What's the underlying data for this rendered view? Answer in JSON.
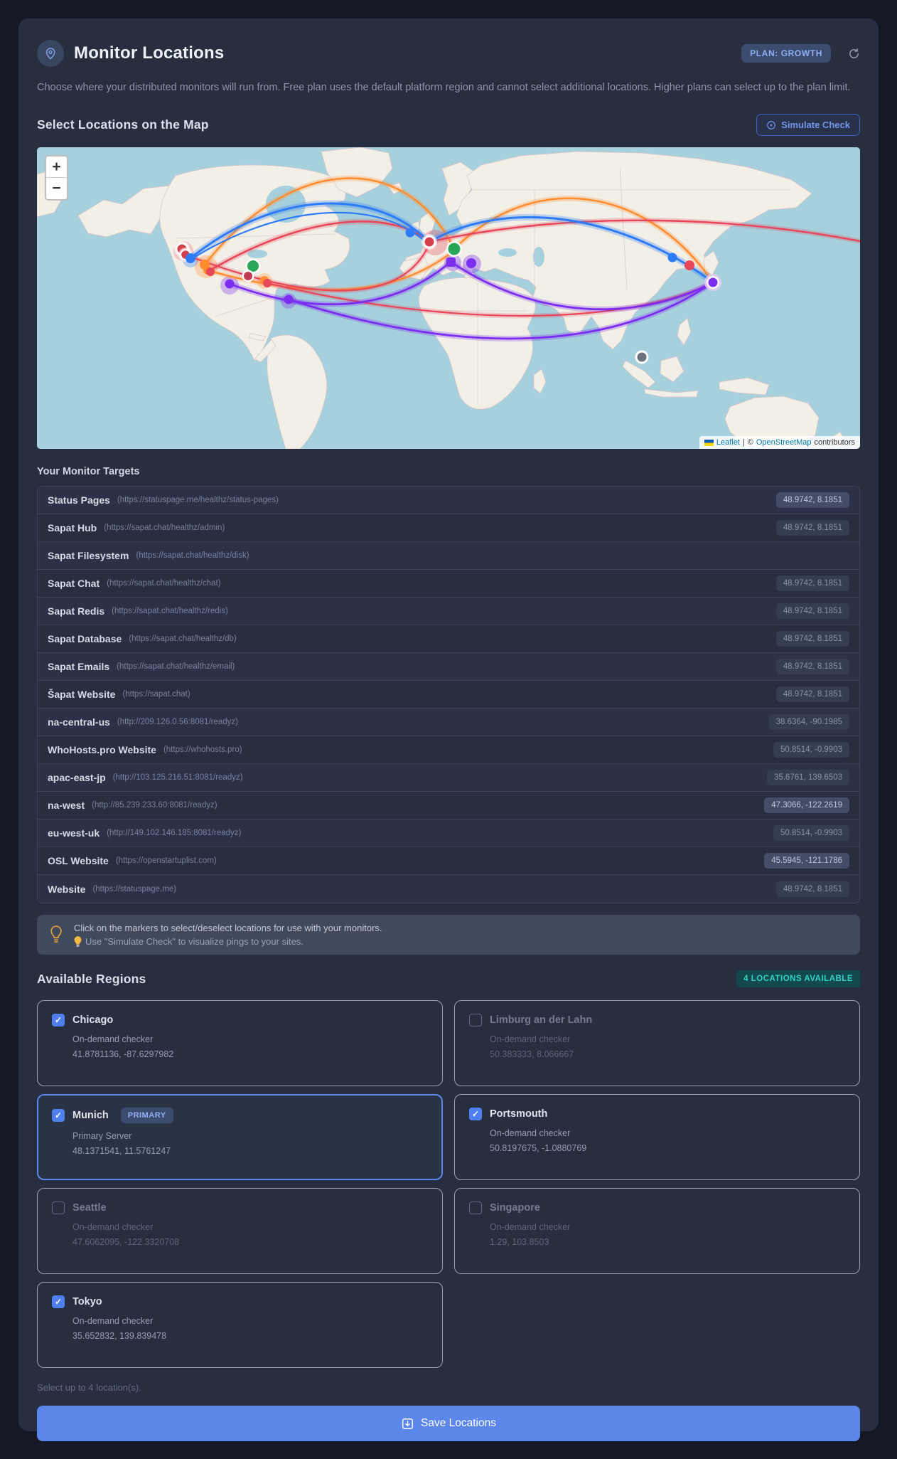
{
  "header": {
    "title": "Monitor Locations",
    "plan_badge": "PLAN: GROWTH",
    "description": "Choose where your distributed monitors will run from. Free plan uses the default platform region and cannot select additional locations. Higher plans can select up to the plan limit."
  },
  "map_section": {
    "heading": "Select Locations on the Map",
    "simulate_button": "Simulate Check",
    "zoom_in": "+",
    "zoom_out": "−",
    "attribution": {
      "leaflet_link": "Leaflet",
      "separator": "|",
      "copyright": "©",
      "osm_link": "OpenStreetMap",
      "suffix": "contributors"
    }
  },
  "map_palette": {
    "blue": "#2e7bf6",
    "orange": "#ff8c2e",
    "red": "#e8465a",
    "purple": "#7c2ef0",
    "green": "#27a658",
    "gray": "#6b7280",
    "water": "#a7d0dd",
    "land": "#f2efe6"
  },
  "targets": {
    "heading": "Your Monitor Targets",
    "items": [
      {
        "name": "Status Pages",
        "url": "(https://statuspage.me/healthz/status-pages)",
        "coords": "48.9742, 8.1851",
        "bright": true
      },
      {
        "name": "Sapat Hub",
        "url": "(https://sapat.chat/healthz/admin)",
        "coords": "48.9742, 8.1851",
        "bright": false
      },
      {
        "name": "Sapat Filesystem",
        "url": "(https://sapat.chat/healthz/disk)",
        "coords": "",
        "bright": false
      },
      {
        "name": "Sapat Chat",
        "url": "(https://sapat.chat/healthz/chat)",
        "coords": "48.9742, 8.1851",
        "bright": false
      },
      {
        "name": "Sapat Redis",
        "url": "(https://sapat.chat/healthz/redis)",
        "coords": "48.9742, 8.1851",
        "bright": false
      },
      {
        "name": "Sapat Database",
        "url": "(https://sapat.chat/healthz/db)",
        "coords": "48.9742, 8.1851",
        "bright": false
      },
      {
        "name": "Sapat Emails",
        "url": "(https://sapat.chat/healthz/email)",
        "coords": "48.9742, 8.1851",
        "bright": false
      },
      {
        "name": "Šapat Website",
        "url": "(https://sapat.chat)",
        "coords": "48.9742, 8.1851",
        "bright": false
      },
      {
        "name": "na-central-us",
        "url": "(http://209.126.0.56:8081/readyz)",
        "coords": "38.6364, -90.1985",
        "bright": false
      },
      {
        "name": "WhoHosts.pro Website",
        "url": "(https://whohosts.pro)",
        "coords": "50.8514, -0.9903",
        "bright": false
      },
      {
        "name": "apac-east-jp",
        "url": "(http://103.125.216.51:8081/readyz)",
        "coords": "35.6761, 139.6503",
        "bright": false
      },
      {
        "name": "na-west",
        "url": "(http://85.239.233.60:8081/readyz)",
        "coords": "47.3066, -122.2619",
        "bright": true
      },
      {
        "name": "eu-west-uk",
        "url": "(http://149.102.146.185:8081/readyz)",
        "coords": "50.8514, -0.9903",
        "bright": false
      },
      {
        "name": "OSL Website",
        "url": "(https://openstartuplist.com)",
        "coords": "45.5945, -121.1786",
        "bright": true
      },
      {
        "name": "Website",
        "url": "(https://statuspage.me)",
        "coords": "48.9742, 8.1851",
        "bright": false
      }
    ]
  },
  "tip": {
    "line1": "Click on the markers to select/deselect locations for use with your monitors.",
    "line2": "Use \"Simulate Check\" to visualize pings to your sites."
  },
  "regions": {
    "heading": "Available Regions",
    "availability_badge": "4 LOCATIONS AVAILABLE",
    "primary_label": "PRIMARY",
    "footnote": "Select up to 4 location(s).",
    "cards": [
      {
        "name": "Chicago",
        "checked": true,
        "primary": false,
        "type": "On-demand checker",
        "coords": "41.8781136, -87.6297982"
      },
      {
        "name": "Limburg an der Lahn",
        "checked": false,
        "primary": false,
        "type": "On-demand checker",
        "coords": "50.383333, 8.066667"
      },
      {
        "name": "Munich",
        "checked": true,
        "primary": true,
        "type": "Primary Server",
        "coords": "48.1371541, 11.5761247"
      },
      {
        "name": "Portsmouth",
        "checked": true,
        "primary": false,
        "type": "On-demand checker",
        "coords": "50.8197675, -1.0880769"
      },
      {
        "name": "Seattle",
        "checked": false,
        "primary": false,
        "type": "On-demand checker",
        "coords": "47.6062095, -122.3320708"
      },
      {
        "name": "Singapore",
        "checked": false,
        "primary": false,
        "type": "On-demand checker",
        "coords": "1.29, 103.8503"
      },
      {
        "name": "Tokyo",
        "checked": true,
        "primary": false,
        "type": "On-demand checker",
        "coords": "35.652832, 139.839478"
      }
    ]
  },
  "save_button": "Save Locations"
}
